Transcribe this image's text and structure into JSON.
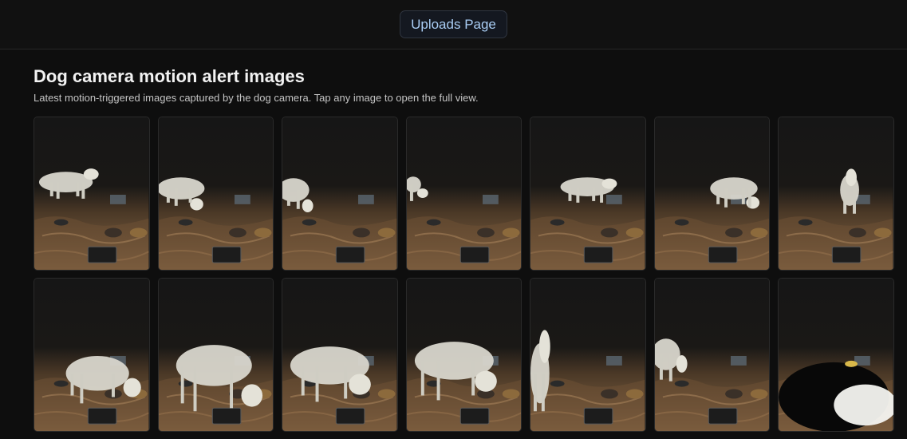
{
  "header": {
    "uploads_label": "Uploads Page"
  },
  "page": {
    "title": "Dog camera motion alert images",
    "subtitle": "Latest motion-triggered images captured by the dog camera. Tap any image to open the full view."
  },
  "gallery": {
    "images": [
      {
        "label": "motion-image-1",
        "dog": "walking-left-edge"
      },
      {
        "label": "motion-image-2",
        "dog": "eating-left"
      },
      {
        "label": "motion-image-3",
        "dog": "partial-left"
      },
      {
        "label": "motion-image-4",
        "dog": "tail-left-edge"
      },
      {
        "label": "motion-image-5",
        "dog": "walking-center"
      },
      {
        "label": "motion-image-6",
        "dog": "sniffing-right"
      },
      {
        "label": "motion-image-7",
        "dog": "rear-view-center"
      },
      {
        "label": "motion-image-8",
        "dog": "close-sniffing"
      },
      {
        "label": "motion-image-9",
        "dog": "close-large"
      },
      {
        "label": "motion-image-10",
        "dog": "close-eating"
      },
      {
        "label": "motion-image-11",
        "dog": "close-eating-2"
      },
      {
        "label": "motion-image-12",
        "dog": "leg-left-edge"
      },
      {
        "label": "motion-image-13",
        "dog": "standing-left"
      },
      {
        "label": "motion-image-14",
        "dog": "blurred-dark"
      }
    ]
  },
  "colors": {
    "background": "#0e0e0e",
    "button_text": "#a9cdf4",
    "ground": "#7a5a3c",
    "dog": "#d8d6cc"
  }
}
